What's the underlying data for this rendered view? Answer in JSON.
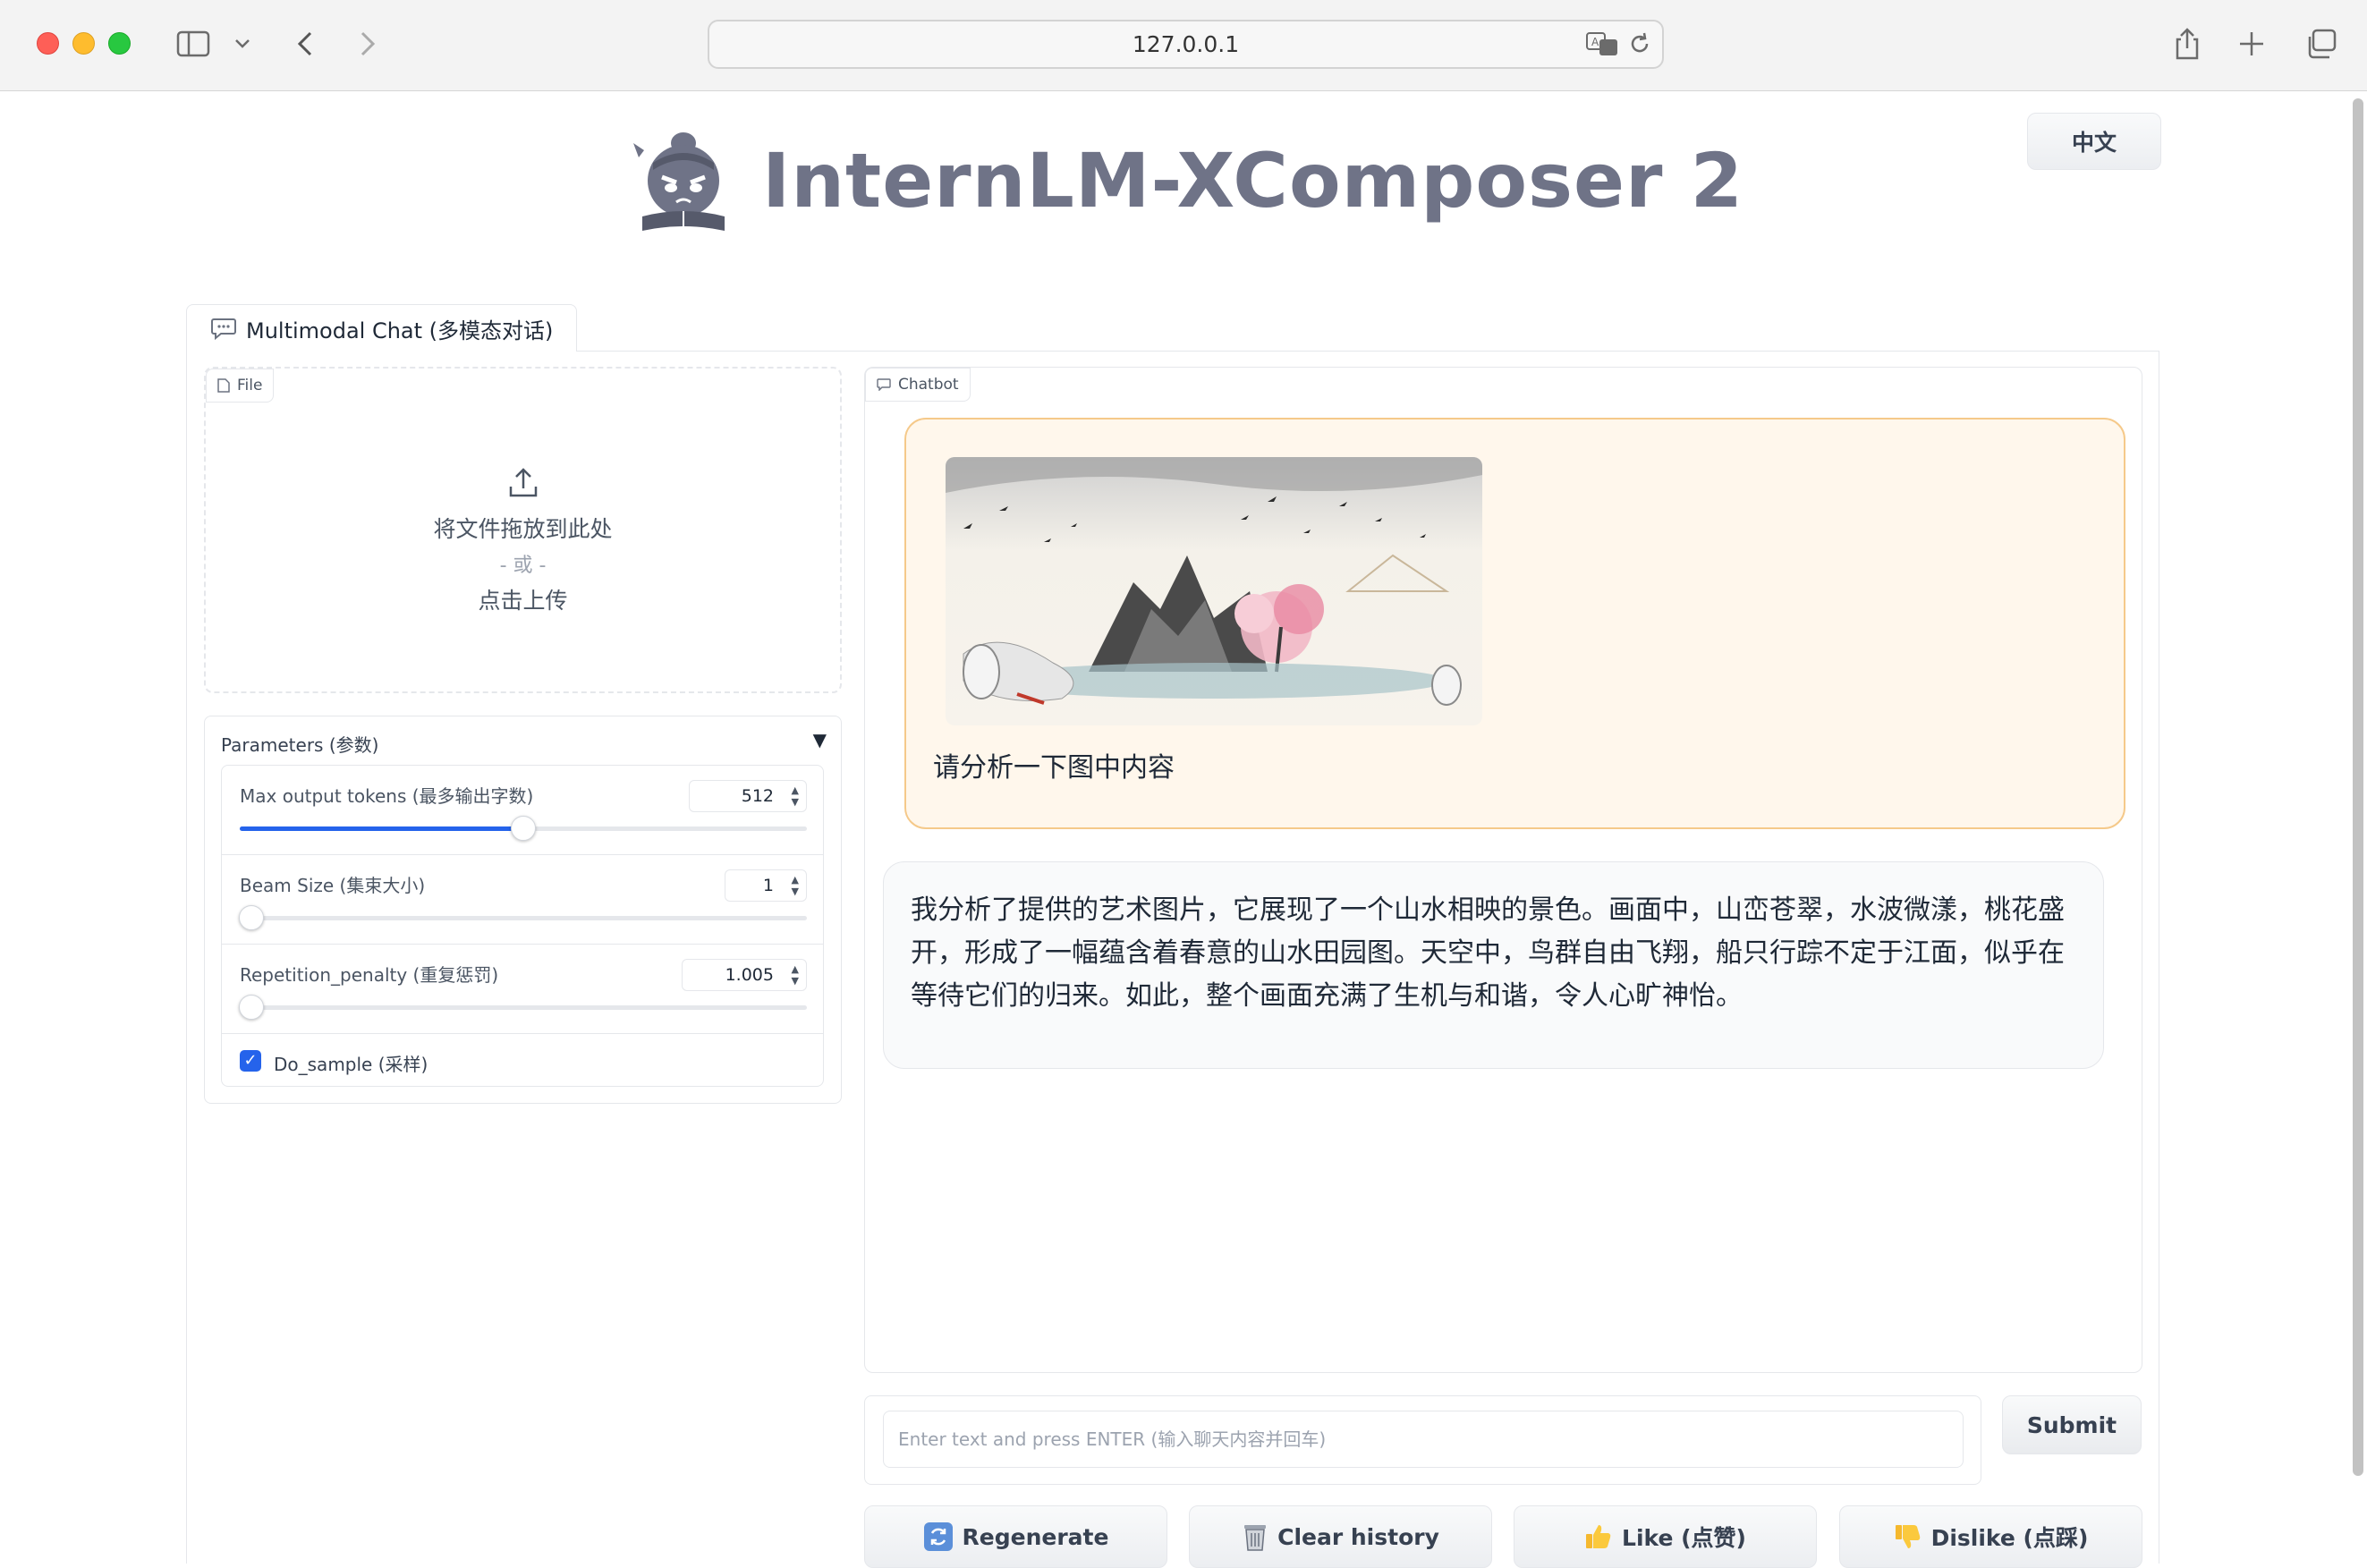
{
  "browser": {
    "url": "127.0.0.1"
  },
  "header": {
    "app_title": "InternLM-XComposer 2",
    "language_button": "中文"
  },
  "tabs": [
    {
      "label": "Multimodal Chat (多模态对话)",
      "icon": "speech-bubble-icon"
    }
  ],
  "file_upload": {
    "label": "File",
    "drop_text": "将文件拖放到此处",
    "or_text": "- 或 -",
    "click_text": "点击上传"
  },
  "parameters": {
    "title": "Parameters (参数)",
    "max_tokens": {
      "label": "Max output tokens (最多输出字数)",
      "value": "512",
      "fraction": 0.5
    },
    "beam_size": {
      "label": "Beam Size (集束大小)",
      "value": "1",
      "fraction": 0.0
    },
    "repetition_penalty": {
      "label": "Repetition_penalty (重复惩罚)",
      "value": "1.005",
      "fraction": 0.005
    },
    "do_sample": {
      "label": "Do_sample (采样)",
      "checked": true
    }
  },
  "chatbot": {
    "label": "Chatbot",
    "user_message": "请分析一下图中内容",
    "bot_message": "我分析了提供的艺术图片，它展现了一个山水相映的景色。画面中，山峦苍翠，水波微漾，桃花盛开，形成了一幅蕴含着春意的山水田园图。天空中，鸟群自由飞翔，船只行踪不定于江面，似乎在等待它们的归来。如此，整个画面充满了生机与和谐，令人心旷神怡。"
  },
  "input": {
    "placeholder": "Enter text and press ENTER (输入聊天内容并回车)",
    "submit_label": "Submit"
  },
  "actions": {
    "regenerate": "Regenerate",
    "clear_history": "Clear history",
    "like": "Like (点赞)",
    "dislike": "Dislike (点踩)"
  },
  "colors": {
    "accent": "#2563eb",
    "title": "#6f7387",
    "user_bubble_bg": "#fff7ec",
    "user_bubble_border": "#f5c98a"
  }
}
